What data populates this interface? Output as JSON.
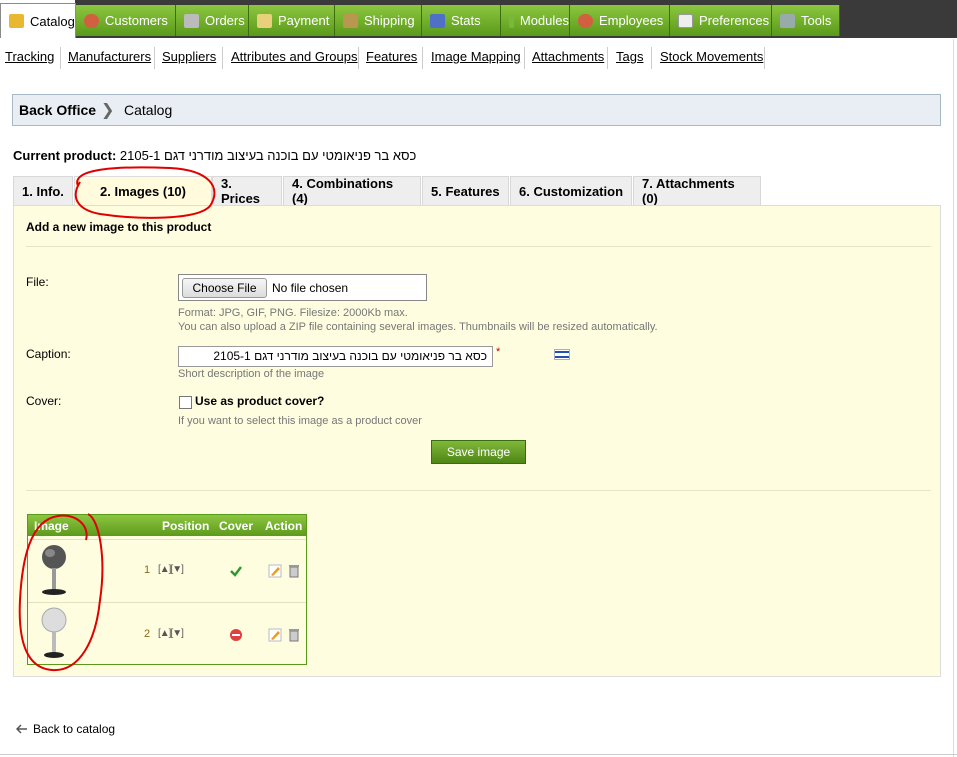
{
  "topnav": {
    "tabs": [
      {
        "label": "Catalog",
        "icon": "folder-icon"
      },
      {
        "label": "Customers",
        "icon": "customers-icon"
      },
      {
        "label": "Orders",
        "icon": "cart-icon"
      },
      {
        "label": "Payment",
        "icon": "payment-icon"
      },
      {
        "label": "Shipping",
        "icon": "truck-icon"
      },
      {
        "label": "Stats",
        "icon": "chart-icon"
      },
      {
        "label": "Modules",
        "icon": "puzzle-icon"
      },
      {
        "label": "Employees",
        "icon": "employee-icon"
      },
      {
        "label": "Preferences",
        "icon": "preferences-icon"
      },
      {
        "label": "Tools",
        "icon": "wrench-icon"
      }
    ]
  },
  "subnav": {
    "items": [
      "Tracking",
      "Manufacturers",
      "Suppliers",
      "Attributes and Groups",
      "Features",
      "Image Mapping",
      "Attachments",
      "Tags",
      "Stock Movements"
    ]
  },
  "breadcrumb": {
    "root": "Back Office",
    "current": "Catalog"
  },
  "current_product": {
    "label": "Current product:",
    "name": "כסא בר פניאומטי עם בוכנה בעיצוב מודרני דגם 2105-1"
  },
  "product_tabs": [
    "1. Info.",
    "2. Images (10)",
    "3. Prices",
    "4. Combinations (4)",
    "5. Features",
    "6. Customization",
    "7. Attachments (0)"
  ],
  "form": {
    "heading": "Add a new image to this product",
    "file_label": "File:",
    "choose_file": "Choose File",
    "no_file": "No file chosen",
    "file_hint1": "Format: JPG, GIF, PNG. Filesize: 2000Kb max.",
    "file_hint2": "You can also upload a ZIP file containing several images. Thumbnails will be resized automatically.",
    "caption_label": "Caption:",
    "caption_value": "כסא בר פניאומטי עם בוכנה בעיצוב מודרני דגם 2105-1",
    "required_mark": "*",
    "caption_hint": "Short description of the image",
    "cover_label": "Cover:",
    "cover_checkbox_label": "Use as product cover?",
    "cover_hint": "If you want to select this image as a product cover",
    "save_button": "Save image"
  },
  "image_table": {
    "headers": {
      "image": "Image",
      "position": "Position",
      "cover": "Cover",
      "action": "Action"
    },
    "rows": [
      {
        "position": "1",
        "arrows": "[▲][▼]",
        "cover": "check-icon"
      },
      {
        "position": "2",
        "arrows": "[▲][▼]",
        "cover": "no-entry-icon"
      }
    ]
  },
  "back_link": "Back to catalog",
  "colors": {
    "green": "#6aaa24",
    "panel_bg": "#fefde0",
    "annotation_red": "#e00000"
  }
}
